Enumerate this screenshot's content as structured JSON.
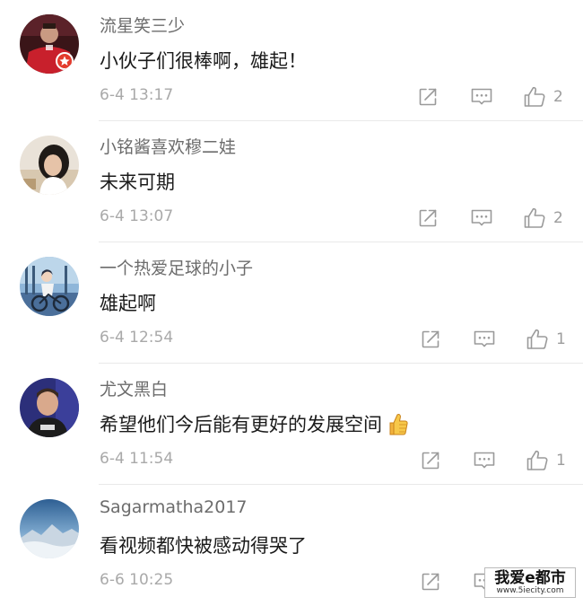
{
  "comments": [
    {
      "username": "流星笑三少",
      "content": "小伙子们很棒啊，雄起！",
      "timestamp": "6-4 13:17",
      "likes": "2",
      "avatar_icon": "user-avatar-red-jersey"
    },
    {
      "username": "小铭酱喜欢穆二娃",
      "content": "未来可期",
      "timestamp": "6-4 13:07",
      "likes": "2",
      "avatar_icon": "user-avatar-girl"
    },
    {
      "username": "一个热爱足球的小子",
      "content": "雄起啊",
      "timestamp": "6-4 12:54",
      "likes": "1",
      "avatar_icon": "user-avatar-anime-cyclist"
    },
    {
      "username": "尤文黑白",
      "content": "希望他们今后能有更好的发展空间",
      "timestamp": "6-4 11:54",
      "likes": "1",
      "avatar_icon": "user-avatar-man",
      "emoji": "thumbs-up-emoji"
    },
    {
      "username": "Sagarmatha2017",
      "content": "看视频都快被感动得哭了",
      "timestamp": "6-6 10:25",
      "likes": "",
      "avatar_icon": "user-avatar-mountain"
    }
  ],
  "watermark": {
    "main": "我爱e都市",
    "sub": "www.5iecity.com"
  },
  "colors": {
    "username": "#6c6c6c",
    "content": "#1b1b1b",
    "timestamp": "#a9a9a9",
    "icon": "#9a9a9a",
    "divider": "#e9e9e9"
  }
}
